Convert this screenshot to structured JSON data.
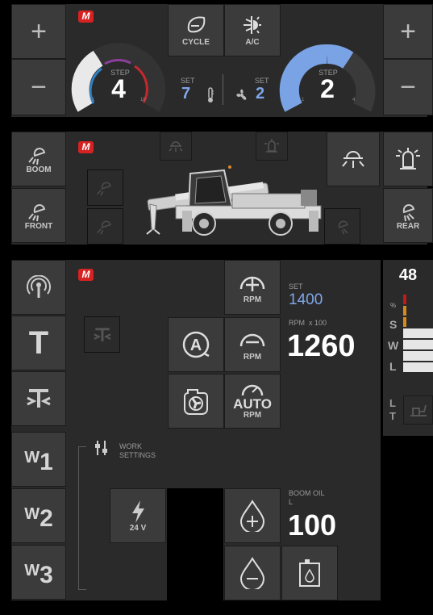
{
  "top": {
    "cycle_label": "CYCLE",
    "ac_label": "A/C",
    "heat_step_label": "STEP",
    "heat_step_value": "4",
    "heat_gauge_tick_min": "1",
    "heat_gauge_tick_max": "10",
    "heat_set_label": "SET",
    "heat_set_value": "7",
    "fan_set_label": "SET",
    "fan_set_value": "2",
    "fan_step_label": "STEP",
    "fan_step_value": "2",
    "fan_gauge_tick_min": "1",
    "fan_gauge_tick_max": "4",
    "plus_glyph": "+",
    "minus_glyph": "−"
  },
  "lights": {
    "boom_label": "BOOM",
    "front_label": "FRONT",
    "rear_label": "REAR"
  },
  "controls": {
    "rpm_plus_label": "RPM",
    "rpm_minus_label": "RPM",
    "auto_label": "AUTO",
    "auto_rpm_label": "RPM",
    "rpm_set_label": "SET",
    "rpm_set_value": "1400",
    "rpm_unit_label": "RPM  x 100",
    "rpm_value": "1260",
    "t_label": "T",
    "w1_letter": "W",
    "w1_number": "1",
    "w2_letter": "W",
    "w2_number": "2",
    "w3_letter": "W",
    "w3_number": "3",
    "work_settings_line1": "WORK",
    "work_settings_line2": "SETTINGS",
    "volt_label": "24 V",
    "boom_oil_label": "BOOM OIL",
    "boom_oil_unit": "L",
    "boom_oil_value": "100",
    "load_value": "48",
    "load_letters": [
      "%",
      "S",
      "W",
      "L"
    ],
    "lt_l": "L",
    "lt_t": "T"
  },
  "colors": {
    "panel": "#2a2a2a",
    "button": "#3b3b3b",
    "accent_blue": "#7fa6e8",
    "brand_red": "#d72222"
  }
}
